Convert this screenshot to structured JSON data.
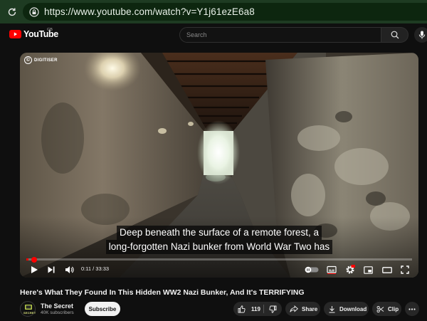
{
  "browser": {
    "url": "https://www.youtube.com/watch?v=Y1j61ezE6a8"
  },
  "header": {
    "logo_text": "YouTube",
    "region": "GB",
    "search_placeholder": "Search"
  },
  "player": {
    "watermark": "DIGITISER",
    "captions": [
      "Deep beneath the surface of a remote forest, a",
      "long-forgotten Nazi bunker from World War Two has"
    ],
    "time": "0:11 / 33:33",
    "progress_percent": 0.6,
    "notification_badge": "HD"
  },
  "video": {
    "title": "Here's What They Found In This Hidden WW2 Nazi Bunker, And It's TERRIFYING",
    "channel": "The Secret",
    "subscribers": "40K subscribers",
    "subscribe_label": "Subscribe",
    "avatar_text": "SECRET"
  },
  "actions": {
    "likes": "119",
    "share": "Share",
    "download": "Download",
    "clip": "Clip"
  },
  "colors": {
    "accent": "#ff0000",
    "browser_bar": "#1e3b22",
    "background": "#0f0f0f"
  }
}
